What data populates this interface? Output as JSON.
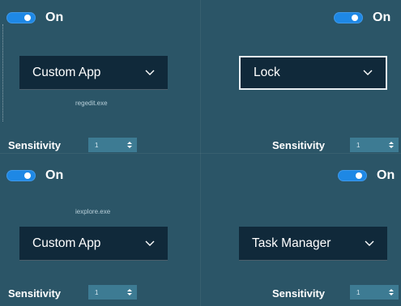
{
  "panels": [
    {
      "toggle": {
        "label": "On"
      },
      "dropdown": {
        "value": "Custom App"
      },
      "exe": "regedit.exe",
      "sensitivity": {
        "label": "Sensitivity",
        "value": "1"
      }
    },
    {
      "toggle": {
        "label": "On"
      },
      "dropdown": {
        "value": "Lock"
      },
      "sensitivity": {
        "label": "Sensitivity",
        "value": "1"
      }
    },
    {
      "toggle": {
        "label": "On"
      },
      "dropdown": {
        "value": "Custom App"
      },
      "exe": "iexplore.exe",
      "sensitivity": {
        "label": "Sensitivity",
        "value": "1"
      }
    },
    {
      "toggle": {
        "label": "On"
      },
      "dropdown": {
        "value": "Task Manager"
      },
      "sensitivity": {
        "label": "Sensitivity",
        "value": "1"
      }
    }
  ],
  "colors": {
    "background": "#2b5567",
    "toggle_on": "#1e88e5",
    "dropdown_bg": "#10293a",
    "spinner_bg": "#3d7b93"
  }
}
